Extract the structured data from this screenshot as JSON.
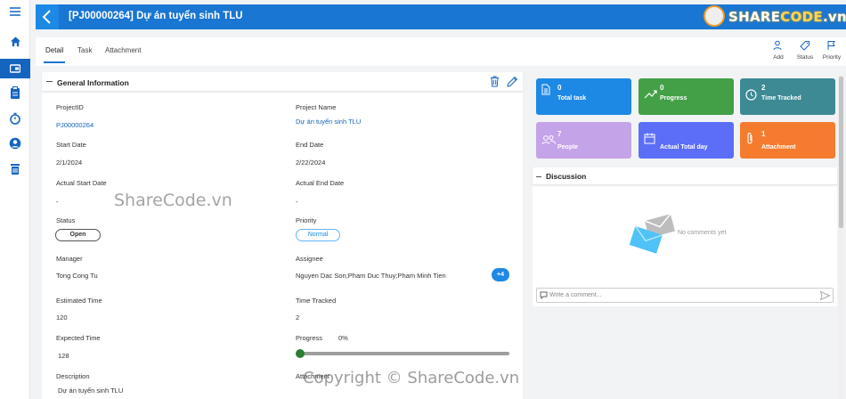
{
  "header": {
    "title": "[PJ00000264] Dự án tuyển sinh TLU"
  },
  "logo": {
    "brand_a": "SHARE",
    "brand_b": "CODE",
    "brand_c": ".vn"
  },
  "tabs": [
    {
      "label": "Detail"
    },
    {
      "label": "Task"
    },
    {
      "label": "Attachment"
    }
  ],
  "actions": [
    {
      "label": "Add"
    },
    {
      "label": "Status"
    },
    {
      "label": "Priority"
    }
  ],
  "general": {
    "title": "General Information",
    "project_id": {
      "label": "ProjectID",
      "value": "PJ00000264"
    },
    "project_name": {
      "label": "Project Name",
      "value": "Dự án tuyển sinh TLU"
    },
    "start_date": {
      "label": "Start Date",
      "value": "2/1/2024"
    },
    "end_date": {
      "label": "End Date",
      "value": "2/22/2024"
    },
    "actual_start": {
      "label": "Actual Start Date",
      "value": "-"
    },
    "actual_end": {
      "label": "Actual End Date",
      "value": "-"
    },
    "status": {
      "label": "Status",
      "value": "Open"
    },
    "priority": {
      "label": "Priority",
      "value": "Normal"
    },
    "manager": {
      "label": "Manager",
      "value": "Tong Cong Tu"
    },
    "assignee": {
      "label": "Assignee",
      "value": "Nguyen Dac Son;Pham Duc Thuy;Pham Minh Tien",
      "more": "+4"
    },
    "estimated": {
      "label": "Estimated Time",
      "value": "120"
    },
    "tracked": {
      "label": "Time Tracked",
      "value": "2"
    },
    "expected": {
      "label": "Expected Time",
      "value": "128"
    },
    "progress": {
      "label": "Progress",
      "value": "0%",
      "fraction": 0
    },
    "description": {
      "label": "Description",
      "value": "Dự án tuyển sinh TLU"
    },
    "attachment": {
      "label": "Attachment"
    }
  },
  "stats": [
    {
      "value": "0",
      "label": "Total task",
      "color": "#1e88e5"
    },
    {
      "value": "0",
      "label": "Progress",
      "color": "#43a047"
    },
    {
      "value": "2",
      "label": "Time Tracked",
      "color": "#3d8a95"
    },
    {
      "value": "7",
      "label": "People",
      "color": "#c5a3e8"
    },
    {
      "value": "",
      "label": "Actual Total day",
      "color": "#5c6ef8"
    },
    {
      "value": "1",
      "label": "Attachment",
      "color": "#f57c2e"
    }
  ],
  "discussion": {
    "title": "Discussion",
    "empty": "No comments yet",
    "placeholder": "Write a comment..."
  },
  "watermarks": {
    "center": "ShareCode.vn",
    "bottom": "Copyright © ShareCode.vn"
  }
}
